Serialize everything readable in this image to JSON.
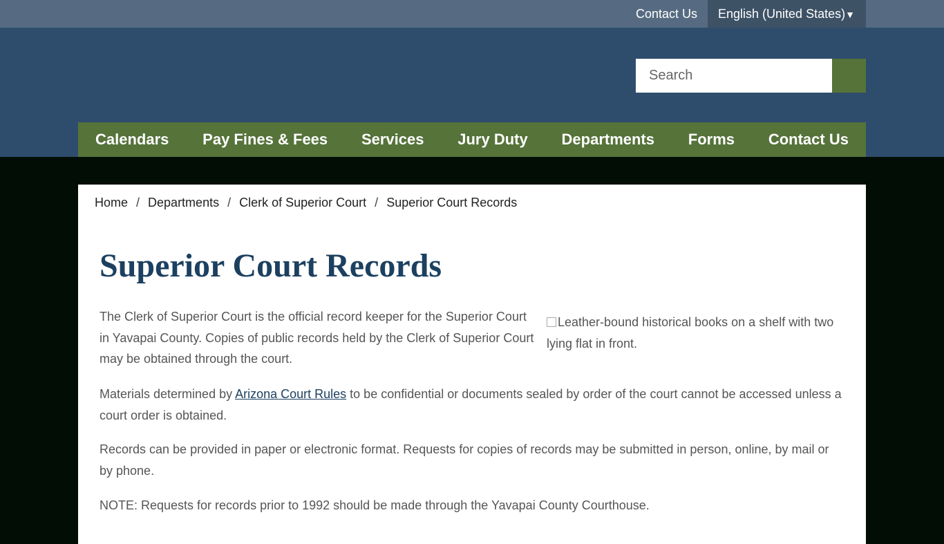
{
  "utility": {
    "contact_label": "Contact Us",
    "language_label": "English (United States)",
    "language_caret": "▼"
  },
  "search": {
    "placeholder": "Search",
    "button_icon": "search-icon"
  },
  "nav": {
    "items": [
      {
        "label": "Calendars"
      },
      {
        "label": "Pay Fines & Fees"
      },
      {
        "label": "Services"
      },
      {
        "label": "Jury Duty"
      },
      {
        "label": "Departments"
      },
      {
        "label": "Forms"
      },
      {
        "label": "Contact Us"
      }
    ]
  },
  "breadcrumb": {
    "items": [
      "Home",
      "Departments",
      "Clerk of Superior Court",
      "Superior Court Records"
    ],
    "separator": "/"
  },
  "page": {
    "title": "Superior Court Records",
    "p1": "The Clerk of Superior Court is the official record keeper for the Superior Court in Yavapai County. Copies of public records held by the Clerk of Superior Court may be obtained through the court.",
    "p2_before": "Materials determined by ",
    "p2_link": "Arizona Court Rules",
    "p2_after": " to be confidential or documents sealed by order of the court cannot be accessed unless a court order is obtained.",
    "p3": "Records can be provided in paper or electronic format. Requests for copies of records may be submitted in person, online, by mail or by phone.",
    "p4": "NOTE: Requests for records prior to 1992 should be made through the Yavapai County Courthouse.",
    "image_alt": "Leather-bound historical books on a shelf with two lying flat in front."
  },
  "colors": {
    "utility_bar": "#566b81",
    "header": "#2e4d6d",
    "nav": "#56733a",
    "title": "#1c4060",
    "page_bg": "#020d05"
  }
}
